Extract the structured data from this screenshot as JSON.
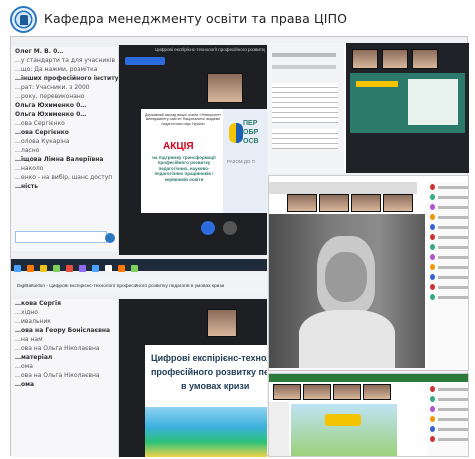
{
  "header": {
    "title": "Кафедра менеджменту освіти та права ЦІПО"
  },
  "top_left_slide": {
    "window_title": "Цифрові експірієнс-технології професійного розвитку пед...",
    "org_lines": "Державний заклад вищої освіти «Університет менеджменту освіти» Національної академії педагогічних наук України",
    "akcia": "АКЦІЯ",
    "body": "на підтримку трансформації професійного розвитку педагогічних, науково-педагогічних працівників і керівників освіти",
    "side_big": "ПЕР ОБР ОСВ",
    "side_small": "РАЗОМ ДО П"
  },
  "bottom_left_slide": {
    "tab_title": "DigiBaltukhin - Цифрові експірієнс-технології професійного розвитку педагогів в умовах кризи",
    "headline_1": "Цифрові експірієнс-технол",
    "headline_2": "професійного розвитку педа",
    "headline_3": "в умовах кризи"
  },
  "chat_top": [
    "Олег М. В. 0…",
    "…у стандарти та для учасників",
    "…що: Да нажми, розмітка",
    "…інших професійного інституту",
    "…рат: Учасники. з 2000",
    "…року, перевиконано",
    "Ольга Юхименко 0…",
    "Ольга Юхименко 0…",
    "…ова Сергієнко",
    "…ова Сергієнко",
    "…олова Кукаріна",
    "…ласно",
    "…іщова Лімна Валеріївна",
    "…наколо",
    "…енко - на вибір, шанс доступ",
    "…ність"
  ],
  "chat_bottom": [
    "…кова Сергія",
    "…хідно",
    "…ивальник",
    "…ова на Геору Боніслаєвна",
    "…на нам",
    "…ова на Ольга Ніколаєвна",
    "…матеріал",
    "…ома",
    "…ова на Ольга Ніколаєвна",
    "…ома"
  ],
  "colors": {
    "brand_blue": "#2a78c4",
    "zoom_dark": "#1e1f23",
    "slide_green": "#2c7a6b",
    "akcia_red": "#d0021b"
  },
  "icons": {
    "logo": "university-seal-icon",
    "mic": "microphone-icon",
    "camera": "camera-icon"
  }
}
